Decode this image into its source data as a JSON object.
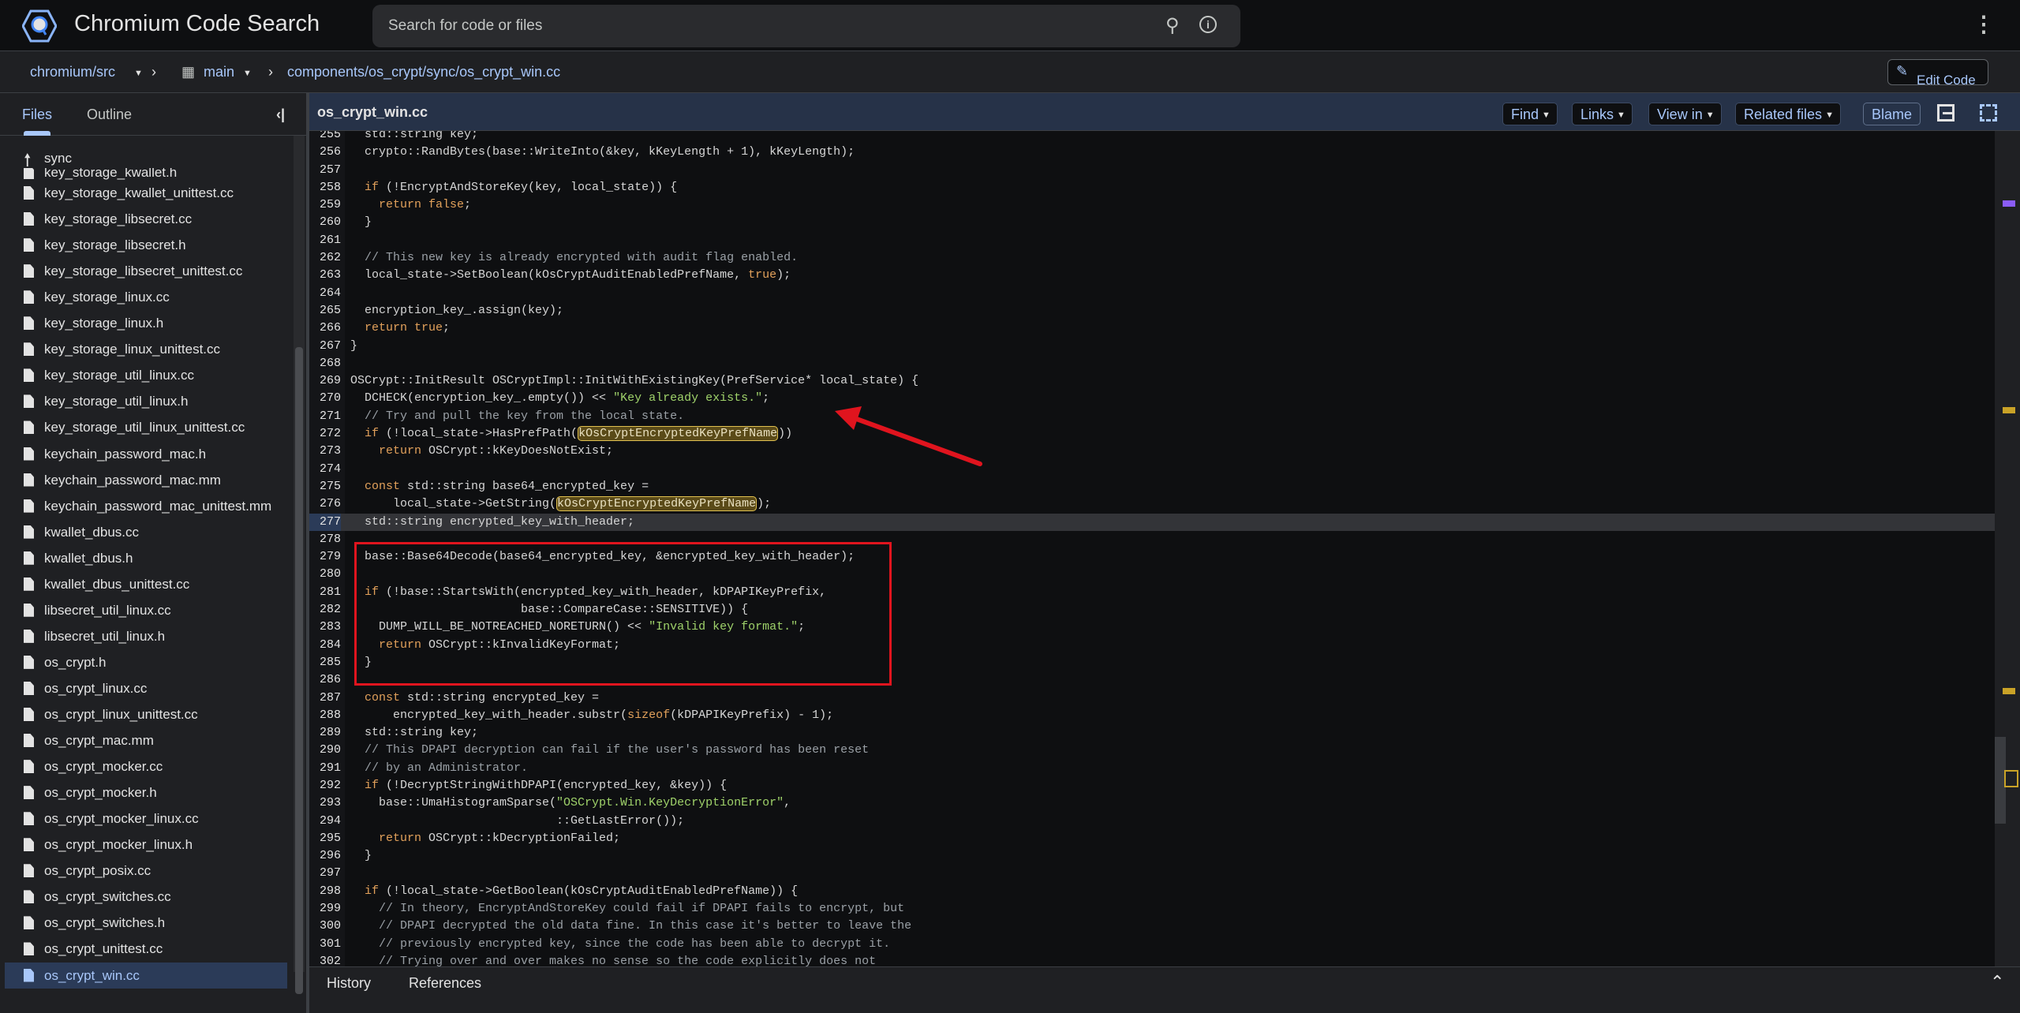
{
  "header": {
    "title": "Chromium Code Search",
    "search_placeholder": "Search for code or files",
    "icons": [
      "search-icon",
      "info-icon",
      "more-vert-icon"
    ]
  },
  "breadcrumb": {
    "repo": "chromium/src",
    "branch": "main",
    "path": "components/os_crypt/sync/os_crypt_win.cc",
    "edit_label": "Edit Code"
  },
  "sidebar": {
    "tabs": [
      "Files",
      "Outline"
    ],
    "active_tab": "Files",
    "parent_dir": "sync",
    "clipped_item": "key_storage_kwallet.h",
    "files": [
      "key_storage_kwallet_unittest.cc",
      "key_storage_libsecret.cc",
      "key_storage_libsecret.h",
      "key_storage_libsecret_unittest.cc",
      "key_storage_linux.cc",
      "key_storage_linux.h",
      "key_storage_linux_unittest.cc",
      "key_storage_util_linux.cc",
      "key_storage_util_linux.h",
      "key_storage_util_linux_unittest.cc",
      "keychain_password_mac.h",
      "keychain_password_mac.mm",
      "keychain_password_mac_unittest.mm",
      "kwallet_dbus.cc",
      "kwallet_dbus.h",
      "kwallet_dbus_unittest.cc",
      "libsecret_util_linux.cc",
      "libsecret_util_linux.h",
      "os_crypt.h",
      "os_crypt_linux.cc",
      "os_crypt_linux_unittest.cc",
      "os_crypt_mac.mm",
      "os_crypt_mocker.cc",
      "os_crypt_mocker.h",
      "os_crypt_mocker_linux.cc",
      "os_crypt_mocker_linux.h",
      "os_crypt_posix.cc",
      "os_crypt_switches.cc",
      "os_crypt_switches.h",
      "os_crypt_unittest.cc",
      "os_crypt_win.cc"
    ],
    "selected": "os_crypt_win.cc"
  },
  "file_header": {
    "name": "os_crypt_win.cc",
    "buttons": [
      "Find",
      "Links",
      "View in",
      "Related files"
    ],
    "blame": "Blame"
  },
  "code": {
    "current_line": "277",
    "lines": [
      {
        "n": "255",
        "t": [
          [
            "",
            "  std::string key;"
          ]
        ]
      },
      {
        "n": "256",
        "t": [
          [
            "",
            "  crypto::RandBytes(base::WriteInto(&key, kKeyLength + 1), kKeyLength);"
          ]
        ]
      },
      {
        "n": "257",
        "t": []
      },
      {
        "n": "258",
        "t": [
          [
            "k",
            "  if"
          ],
          [
            "",
            " (!EncryptAndStoreKey(key, local_state)) {"
          ]
        ]
      },
      {
        "n": "259",
        "t": [
          [
            "k",
            "    return false"
          ],
          [
            "",
            ";"
          ]
        ]
      },
      {
        "n": "260",
        "t": [
          [
            "",
            "  }"
          ]
        ]
      },
      {
        "n": "261",
        "t": []
      },
      {
        "n": "262",
        "t": [
          [
            "c",
            "  // This new key is already encrypted with audit flag enabled."
          ]
        ]
      },
      {
        "n": "263",
        "t": [
          [
            "",
            "  local_state->SetBoolean(kOsCryptAuditEnabledPrefName, "
          ],
          [
            "k",
            "true"
          ],
          [
            "",
            ");"
          ]
        ]
      },
      {
        "n": "264",
        "t": []
      },
      {
        "n": "265",
        "t": [
          [
            "",
            "  encryption_key_.assign(key);"
          ]
        ]
      },
      {
        "n": "266",
        "t": [
          [
            "k",
            "  return true"
          ],
          [
            "",
            ";"
          ]
        ]
      },
      {
        "n": "267",
        "t": [
          [
            "",
            "}"
          ]
        ]
      },
      {
        "n": "268",
        "t": []
      },
      {
        "n": "269",
        "t": [
          [
            "",
            "OSCrypt::InitResult OSCryptImpl::InitWithExistingKey(PrefService* local_state) {"
          ]
        ]
      },
      {
        "n": "270",
        "t": [
          [
            "",
            "  DCHECK(encryption_key_.empty()) << "
          ],
          [
            "s",
            "\"Key already exists.\""
          ],
          [
            "",
            ";"
          ]
        ]
      },
      {
        "n": "271",
        "t": [
          [
            "c",
            "  // Try and pull the key from the local state."
          ]
        ]
      },
      {
        "n": "272",
        "t": [
          [
            "k",
            "  if"
          ],
          [
            "",
            " (!local_state->HasPrefPath("
          ],
          [
            "h",
            "kOsCryptEncryptedKeyPrefName"
          ],
          [
            "",
            "))"
          ]
        ]
      },
      {
        "n": "273",
        "t": [
          [
            "k",
            "    return"
          ],
          [
            "",
            " OSCrypt::kKeyDoesNotExist;"
          ]
        ]
      },
      {
        "n": "274",
        "t": []
      },
      {
        "n": "275",
        "t": [
          [
            "k",
            "  const"
          ],
          [
            "",
            " std::string base64_encrypted_key ="
          ]
        ]
      },
      {
        "n": "276",
        "t": [
          [
            "",
            "      local_state->GetString("
          ],
          [
            "h",
            "kOsCryptEncryptedKeyPrefName"
          ],
          [
            "",
            ");"
          ]
        ]
      },
      {
        "n": "277",
        "t": [
          [
            "",
            "  std::string encrypted_key_with_header;"
          ]
        ]
      },
      {
        "n": "278",
        "t": []
      },
      {
        "n": "279",
        "t": [
          [
            "",
            "  base::Base64Decode(base64_encrypted_key, &encrypted_key_with_header);"
          ]
        ]
      },
      {
        "n": "280",
        "t": []
      },
      {
        "n": "281",
        "t": [
          [
            "k",
            "  if"
          ],
          [
            "",
            " (!base::StartsWith(encrypted_key_with_header, kDPAPIKeyPrefix,"
          ]
        ]
      },
      {
        "n": "282",
        "t": [
          [
            "",
            "                        base::CompareCase::SENSITIVE)) {"
          ]
        ]
      },
      {
        "n": "283",
        "t": [
          [
            "",
            "    DUMP_WILL_BE_NOTREACHED_NORETURN() << "
          ],
          [
            "s",
            "\"Invalid key format.\""
          ],
          [
            "",
            ";"
          ]
        ]
      },
      {
        "n": "284",
        "t": [
          [
            "k",
            "    return"
          ],
          [
            "",
            " OSCrypt::kInvalidKeyFormat;"
          ]
        ]
      },
      {
        "n": "285",
        "t": [
          [
            "",
            "  }"
          ]
        ]
      },
      {
        "n": "286",
        "t": []
      },
      {
        "n": "287",
        "t": [
          [
            "k",
            "  const"
          ],
          [
            "",
            " std::string encrypted_key ="
          ]
        ]
      },
      {
        "n": "288",
        "t": [
          [
            "",
            "      encrypted_key_with_header.substr("
          ],
          [
            "k",
            "sizeof"
          ],
          [
            "",
            "(kDPAPIKeyPrefix) - 1);"
          ]
        ]
      },
      {
        "n": "289",
        "t": [
          [
            "",
            "  std::string key;"
          ]
        ]
      },
      {
        "n": "290",
        "t": [
          [
            "c",
            "  // This DPAPI decryption can fail if the user's password has been reset"
          ]
        ]
      },
      {
        "n": "291",
        "t": [
          [
            "c",
            "  // by an Administrator."
          ]
        ]
      },
      {
        "n": "292",
        "t": [
          [
            "k",
            "  if"
          ],
          [
            "",
            " (!DecryptStringWithDPAPI(encrypted_key, &key)) {"
          ]
        ]
      },
      {
        "n": "293",
        "t": [
          [
            "",
            "    base::UmaHistogramSparse("
          ],
          [
            "s",
            "\"OSCrypt.Win.KeyDecryptionError\""
          ],
          [
            "",
            ","
          ]
        ]
      },
      {
        "n": "294",
        "t": [
          [
            "",
            "                             ::GetLastError());"
          ]
        ]
      },
      {
        "n": "295",
        "t": [
          [
            "k",
            "    return"
          ],
          [
            "",
            " OSCrypt::kDecryptionFailed;"
          ]
        ]
      },
      {
        "n": "296",
        "t": [
          [
            "",
            "  }"
          ]
        ]
      },
      {
        "n": "297",
        "t": []
      },
      {
        "n": "298",
        "t": [
          [
            "k",
            "  if"
          ],
          [
            "",
            " (!local_state->GetBoolean(kOsCryptAuditEnabledPrefName)) {"
          ]
        ]
      },
      {
        "n": "299",
        "t": [
          [
            "c",
            "    // In theory, EncryptAndStoreKey could fail if DPAPI fails to encrypt, but"
          ]
        ]
      },
      {
        "n": "300",
        "t": [
          [
            "c",
            "    // DPAPI decrypted the old data fine. In this case it's better to leave the"
          ]
        ]
      },
      {
        "n": "301",
        "t": [
          [
            "c",
            "    // previously encrypted key, since the code has been able to decrypt it."
          ]
        ]
      },
      {
        "n": "302",
        "t": [
          [
            "c",
            "    // Trying over and over makes no sense so the code explicitly does not"
          ]
        ]
      }
    ]
  },
  "annotations": {
    "highlight_box_color": "#e0141e",
    "arrow_color": "#e0141e"
  },
  "bottom": {
    "tabs": [
      "History",
      "References"
    ]
  },
  "colors": {
    "accent": "#a8c7fa",
    "keyword": "#e2a15b",
    "string": "#9fd26a",
    "comment": "#9aa0a6",
    "header_bar": "#263248"
  }
}
